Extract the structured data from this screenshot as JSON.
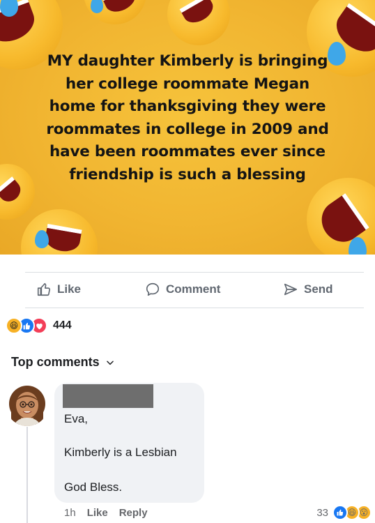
{
  "post": {
    "image_text_lines": [
      "MY daughter Kimberly is bringing",
      "her college roommate Megan",
      "home for thanksgiving they were",
      "roommates in college in 2009 and",
      "have been roommates ever since",
      "friendship is such a blessing"
    ],
    "background_color": "#f1b531",
    "emoji": "face-with-tears-of-joy"
  },
  "actions": {
    "like": "Like",
    "comment": "Comment",
    "send": "Send"
  },
  "reactions": {
    "types": [
      "haha",
      "like",
      "love"
    ],
    "count": "444"
  },
  "comments_header": {
    "label": "Top comments"
  },
  "comment": {
    "author_name": "",
    "lines": [
      "Eva,",
      "Kimberly is a Lesbian",
      "God Bless."
    ],
    "time": "1h",
    "like_label": "Like",
    "reply_label": "Reply",
    "reaction_count": "33",
    "reaction_types": [
      "like",
      "haha",
      "wow"
    ]
  },
  "colors": {
    "like_blue": "#1877f2",
    "love_red": "#f33e58",
    "haha_yellow": "#f7b125",
    "muted_text": "#65676b"
  }
}
